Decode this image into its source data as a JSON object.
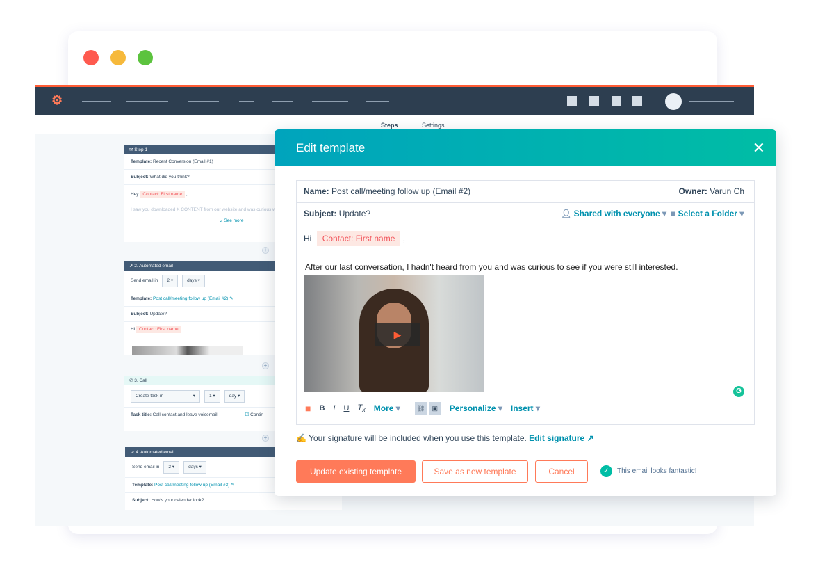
{
  "subnav": {
    "tabs": [
      "Steps",
      "Settings"
    ]
  },
  "steps": [
    {
      "header": "Step 1",
      "template_label": "Template:",
      "template": "Recent Conversion (Email #1)",
      "subject_label": "Subject:",
      "subject": "What did you think?",
      "greeting": "Hey",
      "token": "Contact: First name",
      "body": "I saw you downloaded X CONTENT from our website and was curious w",
      "see_more": "See more"
    },
    {
      "header": "2. Automated email",
      "send_label": "Send email in",
      "num": "2",
      "unit": "days",
      "template_label": "Template:",
      "template": "Post call/meeting follow up (Email #2)",
      "subject_label": "Subject:",
      "subject": "Update?",
      "greeting": "Hi",
      "token": "Contact: First name"
    },
    {
      "header": "3. Call",
      "task_select": "Create task in",
      "num": "1",
      "unit": "day",
      "task_label": "Task title:",
      "task": "Call contact and leave voicemail",
      "continue": "Contin"
    },
    {
      "header": "4. Automated email",
      "send_label": "Send email in",
      "num": "2",
      "unit": "days",
      "template_label": "Template:",
      "template": "Post call/meeting follow up (Email #3)",
      "subject_label": "Subject:",
      "subject": "How's your calendar look?"
    }
  ],
  "modal": {
    "title": "Edit template",
    "name_label": "Name:",
    "name": "Post call/meeting follow up (Email #2)",
    "owner_label": "Owner:",
    "owner": "Varun Ch",
    "subject_label": "Subject:",
    "subject": "Update?",
    "shared": "Shared with everyone",
    "folder": "Select a Folder",
    "greeting": "Hi",
    "token": "Contact: First name",
    "body": "After our last conversation, I hadn't heard from you and was curious to see if you were still interested.",
    "toolbar": {
      "more": "More",
      "personalize": "Personalize",
      "insert": "Insert"
    },
    "signature_text": "Your signature will be included when you use this template.",
    "edit_signature": "Edit signature",
    "update_button": "Update existing template",
    "save_new_button": "Save as new template",
    "cancel_button": "Cancel",
    "status": "This email looks fantastic!"
  },
  "colors": {
    "accent": "#ff7a59",
    "teal": "#00a4bd",
    "nav": "#2d3e50"
  }
}
